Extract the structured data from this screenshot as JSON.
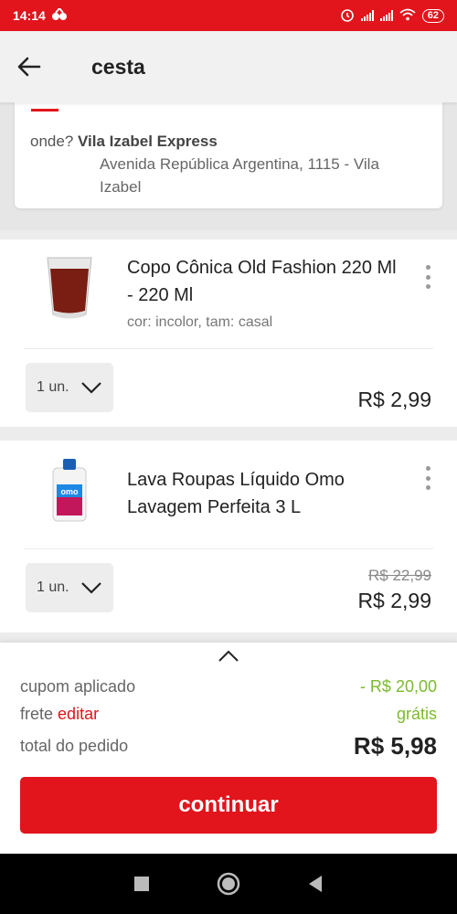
{
  "status_bar": {
    "time": "14:14",
    "battery": "62"
  },
  "header": {
    "title": "cesta"
  },
  "store": {
    "label": "onde?",
    "name": "Vila Izabel Express",
    "address": "Avenida República Argentina, 1115 - Vila Izabel"
  },
  "products": [
    {
      "name": "Copo Cônica Old Fashion 220 Ml - 220 Ml",
      "attributes": "cor: incolor, tam: casal",
      "quantity": "1 un.",
      "price": "R$ 2,99"
    },
    {
      "name": "Lava Roupas Líquido Omo Lavagem Perfeita 3 L",
      "quantity": "1 un.",
      "old_price": "R$ 22,99",
      "price": "R$ 2,99"
    }
  ],
  "summary": {
    "coupon_label": "cupom aplicado",
    "coupon_value": "- R$ 20,00",
    "shipping_label": "frete",
    "shipping_edit": "editar",
    "shipping_value": "grátis",
    "total_label": "total do pedido",
    "total_value": "R$ 5,98",
    "continue_button": "continuar"
  },
  "colors": {
    "brand_red": "#e2141c",
    "green": "#7bbb2c"
  },
  "icons": [
    "back-arrow-icon",
    "kebab-menu-icon",
    "chevron-down-icon",
    "chevron-up-icon",
    "nav-square-icon",
    "nav-home-icon",
    "nav-back-icon"
  ]
}
